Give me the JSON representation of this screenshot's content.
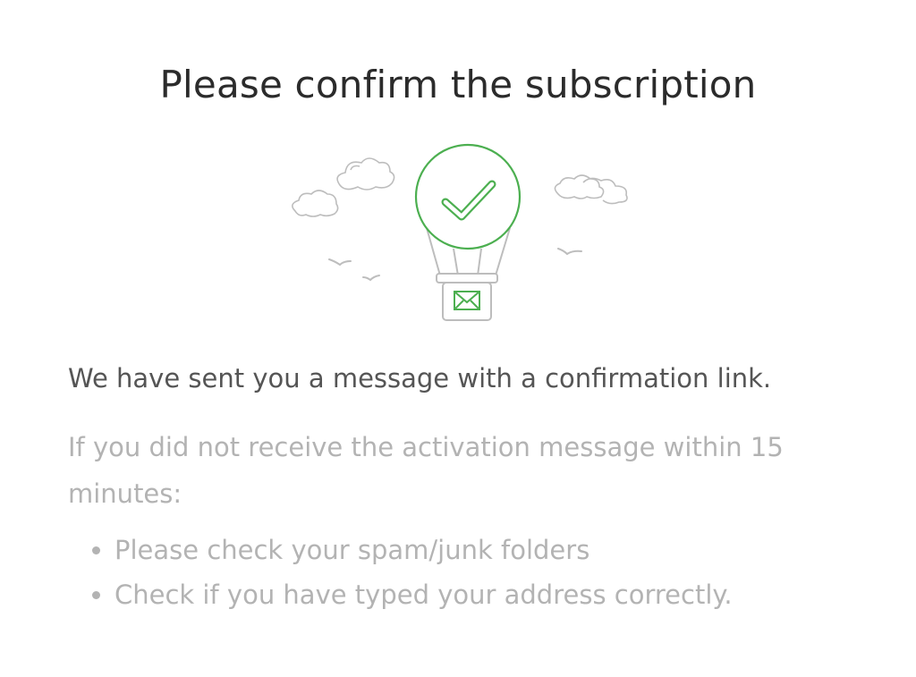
{
  "page": {
    "title": "Please confirm the subscription"
  },
  "illustration": {
    "icon": "hot-air-balloon-with-checkmark-and-envelope",
    "accent_color": "#4caf50",
    "line_color": "#bdbdbd"
  },
  "message": {
    "main": "We have sent you a message with a confirmation link.",
    "hint": "If you did not receive the activation message within 15 minutes:",
    "tips": [
      "Please check your spam/junk folders",
      "Check if you have typed your address correctly."
    ]
  }
}
